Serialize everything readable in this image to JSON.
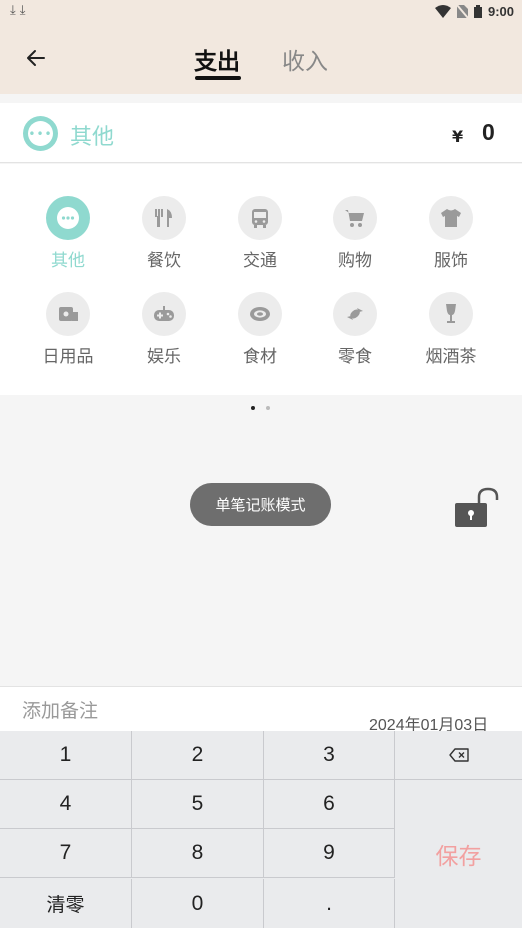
{
  "status_bar": {
    "left_glyphs": "⤓⤓",
    "time": "9:00"
  },
  "header": {
    "tabs": [
      {
        "label": "支出"
      },
      {
        "label": "收入"
      }
    ],
    "active_tab": 0
  },
  "summary": {
    "category_icon_glyph": "•••",
    "category": "其他",
    "currency": "¥",
    "amount": "0"
  },
  "accent_color": "#8fd9cf",
  "categories": [
    {
      "label": "其他",
      "icon": "more-icon",
      "active": true
    },
    {
      "label": "餐饮",
      "icon": "utensils-icon"
    },
    {
      "label": "交通",
      "icon": "bus-icon"
    },
    {
      "label": "购物",
      "icon": "cart-icon"
    },
    {
      "label": "服饰",
      "icon": "shirt-icon"
    },
    {
      "label": "日用品",
      "icon": "tissue-icon"
    },
    {
      "label": "娱乐",
      "icon": "gamepad-icon"
    },
    {
      "label": "食材",
      "icon": "meat-icon"
    },
    {
      "label": "零食",
      "icon": "candy-icon"
    },
    {
      "label": "烟酒茶",
      "icon": "wine-glass-icon"
    }
  ],
  "pager": {
    "pages": 2,
    "current": 1
  },
  "mode_button": {
    "label": "单笔记账模式"
  },
  "note": {
    "placeholder": "添加备注",
    "value": ""
  },
  "date": "2024年01月03日",
  "keypad": {
    "keys": [
      "1",
      "2",
      "3",
      "4",
      "5",
      "6",
      "7",
      "8",
      "9",
      "清零",
      "0",
      "."
    ],
    "backspace_glyph": "⌫",
    "save_label": "保存",
    "save_color": "#f2a0a0"
  }
}
